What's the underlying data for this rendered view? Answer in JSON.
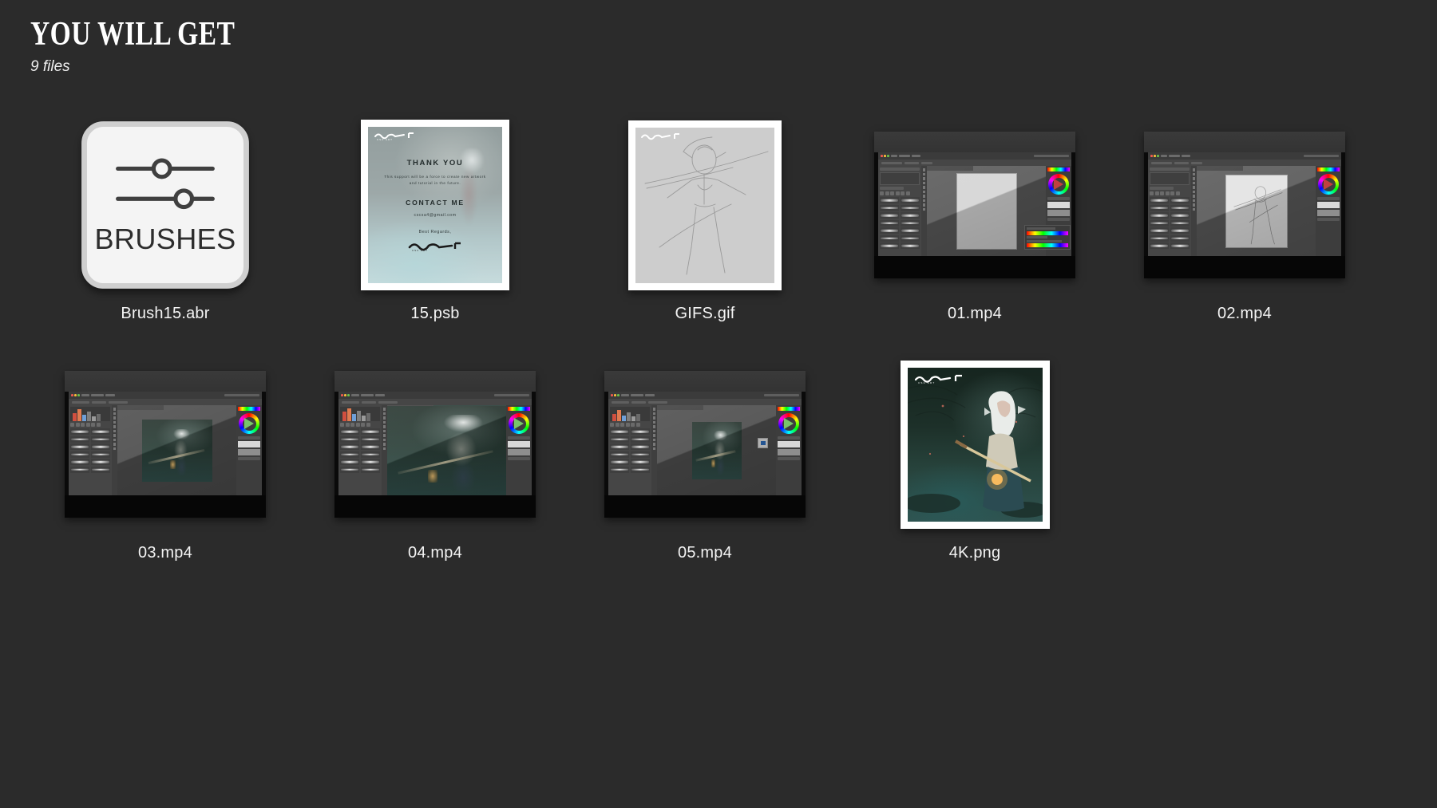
{
  "header": {
    "title": "YOU WILL GET",
    "subtitle": "9 files"
  },
  "colors": {
    "background": "#2b2b2b",
    "text": "#f2f2f2",
    "frame": "#ffffff",
    "brush_card": "#f4f4f4",
    "brush_icon": "#3f3f3f",
    "artwork_teal": "#2f5350",
    "sketch_gray": "#cdcdcd"
  },
  "files": [
    {
      "label": "Brush15.abr",
      "kind": "brush-preset-card",
      "card_text": "BRUSHES",
      "icon": "sliders-icon"
    },
    {
      "label": "15.psb",
      "kind": "framed-image",
      "card": {
        "heading": "THANK YOU",
        "body": "This support will be a force to create new artwork and tutorial in the future.",
        "contact_heading": "CONTACT ME",
        "email": "cscsa4@gmail.com",
        "regards": "Best Regards,",
        "signature": "signature-mark"
      }
    },
    {
      "label": "GIFS.gif",
      "kind": "framed-sketch",
      "watermark": "signature-mark"
    },
    {
      "label": "01.mp4",
      "kind": "screen-recording",
      "scene": "photoshop-blank-canvas"
    },
    {
      "label": "02.mp4",
      "kind": "screen-recording",
      "scene": "photoshop-sketch-canvas"
    },
    {
      "label": "03.mp4",
      "kind": "screen-recording",
      "scene": "photoshop-painting-small"
    },
    {
      "label": "04.mp4",
      "kind": "screen-recording",
      "scene": "photoshop-painting-closeup"
    },
    {
      "label": "05.mp4",
      "kind": "screen-recording",
      "scene": "photoshop-painting-detail"
    },
    {
      "label": "4K.png",
      "kind": "framed-artwork",
      "watermark": "signature-mark"
    }
  ]
}
